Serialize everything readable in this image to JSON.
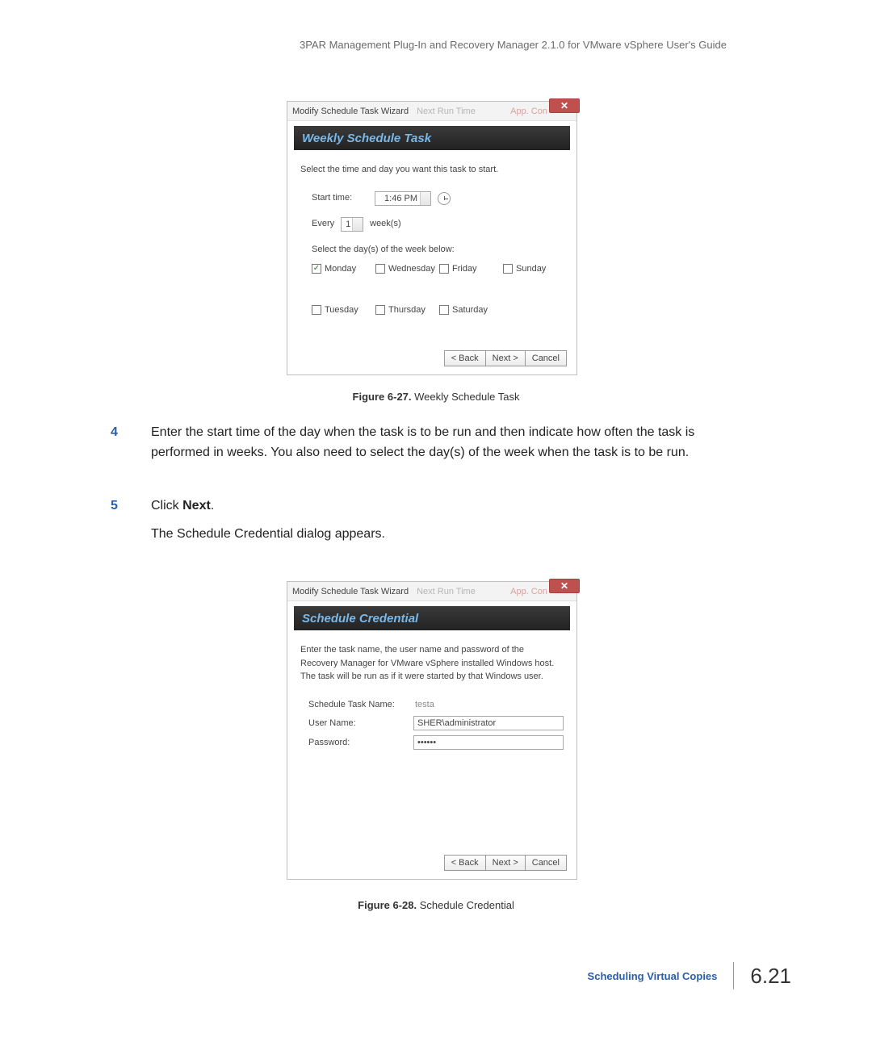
{
  "header": "3PAR Management Plug-In and Recovery Manager 2.1.0 for VMware vSphere User's Guide",
  "dialog1": {
    "title": "Modify Schedule Task Wizard",
    "tab_next": "Next Run Time",
    "tab_app": "App. Con",
    "banner": "Weekly Schedule Task",
    "instruction": "Select the time and day you want this task to start.",
    "start_label": "Start time:",
    "start_value": "1:46 PM",
    "every_label": "Every",
    "every_value": "1",
    "weeks_label": "week(s)",
    "select_days": "Select the day(s) of the week below:",
    "days": [
      {
        "label": "Monday",
        "checked": true
      },
      {
        "label": "Wednesday",
        "checked": false
      },
      {
        "label": "Friday",
        "checked": false
      },
      {
        "label": "Sunday",
        "checked": false
      },
      {
        "label": "Tuesday",
        "checked": false
      },
      {
        "label": "Thursday",
        "checked": false
      },
      {
        "label": "Saturday",
        "checked": false
      }
    ],
    "back": "< Back",
    "next": "Next >",
    "cancel": "Cancel"
  },
  "caption1_label": "Figure 6-27.",
  "caption1_text": "Weekly Schedule Task",
  "step4_num": "4",
  "step4_text": "Enter the start time of the day when the task is to be run and then indicate how often the task is performed in weeks. You also need to select the day(s) of the week when the task is to be run.",
  "step5_num": "5",
  "step5_pre": "Click ",
  "step5_bold": "Next",
  "step5_post": ".",
  "after5": "The Schedule Credential dialog appears.",
  "dialog2": {
    "title": "Modify Schedule Task Wizard",
    "tab_next": "Next Run Time",
    "tab_app": "App. Con",
    "banner": "Schedule Credential",
    "instruction": "Enter the task name, the user name and password of the Recovery Manager for VMware vSphere installed Windows host. The task will be run as if it were started by that Windows user.",
    "taskname_label": "Schedule Task Name:",
    "taskname_value": "testa",
    "username_label": "User Name:",
    "username_value": "SHER\\administrator",
    "password_label": "Password:",
    "password_value": "••••••",
    "back": "< Back",
    "next": "Next >",
    "cancel": "Cancel"
  },
  "caption2_label": "Figure 6-28.",
  "caption2_text": "Schedule Credential",
  "footer_section": "Scheduling Virtual Copies",
  "footer_page": "6.21"
}
